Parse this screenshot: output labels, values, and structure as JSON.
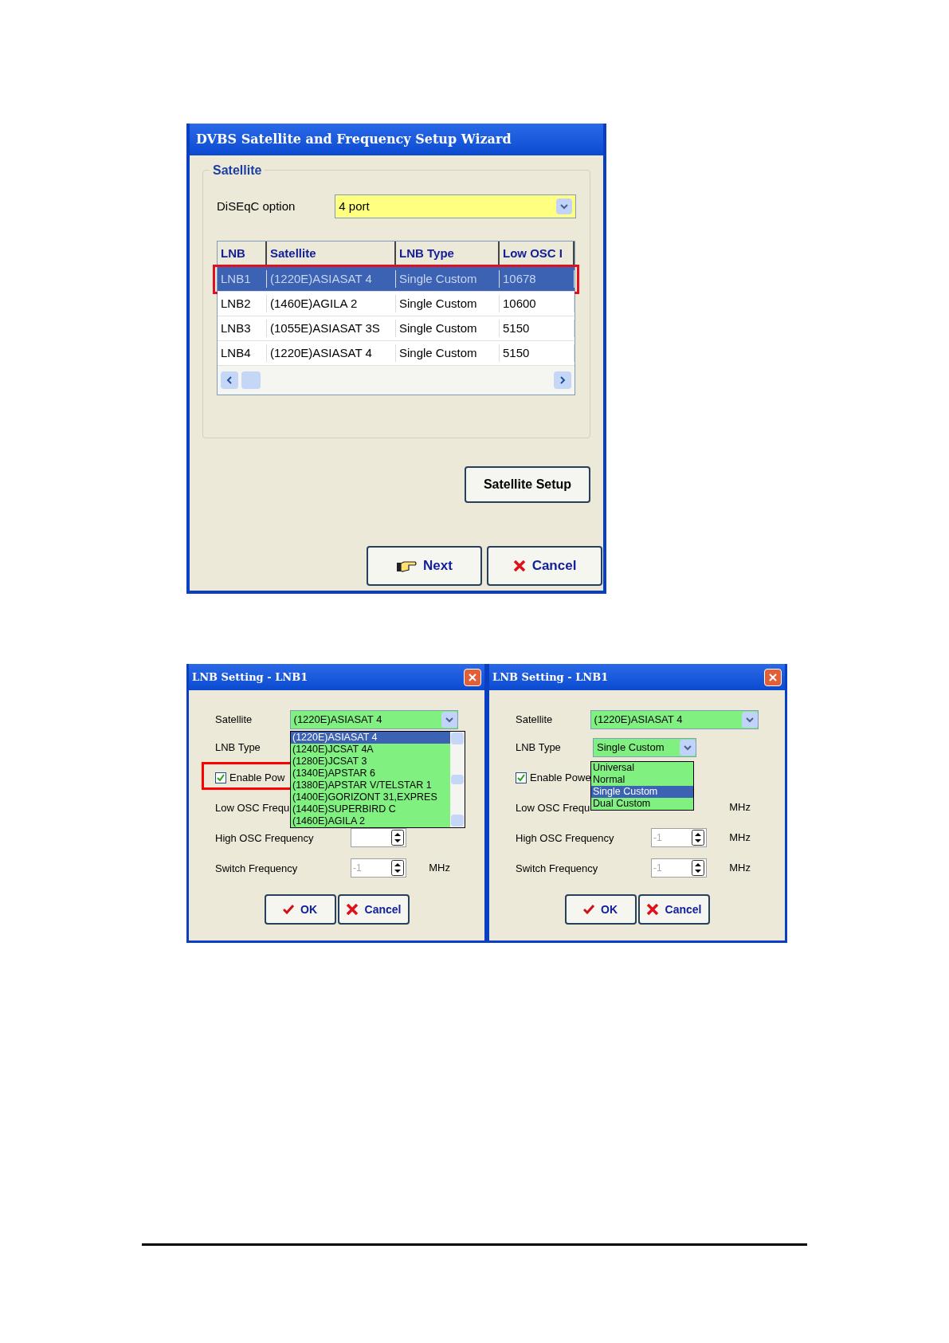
{
  "wizard": {
    "title": "DVBS Satellite and Frequency Setup Wizard",
    "group_title": "Satellite",
    "diseqc_label": "DiSEqC option",
    "diseqc_value": "4 port",
    "table": {
      "columns": [
        "LNB",
        "Satellite",
        "LNB Type",
        "Low OSC I"
      ],
      "rows": [
        {
          "cells": [
            "LNB1",
            "(1220E)ASIASAT 4",
            "Single Custom",
            "10678"
          ],
          "selected": true,
          "highlighted": true
        },
        {
          "cells": [
            "LNB2",
            "(1460E)AGILA 2",
            "Single Custom",
            "10600"
          ],
          "selected": false,
          "highlighted": false
        },
        {
          "cells": [
            "LNB3",
            "(1055E)ASIASAT 3S",
            "Single Custom",
            "5150"
          ],
          "selected": false,
          "highlighted": false
        },
        {
          "cells": [
            "LNB4",
            "(1220E)ASIASAT 4",
            "Single Custom",
            "5150"
          ],
          "selected": false,
          "highlighted": false
        }
      ]
    },
    "setup_button": "Satellite Setup",
    "next_button": "Next",
    "cancel_button": "Cancel"
  },
  "dialogs": [
    {
      "title": "LNB Setting - LNB1",
      "satellite_label": "Satellite",
      "satellite_value": "(1220E)ASIASAT 4",
      "lnb_type_label": "LNB Type",
      "enable_power": {
        "label": "Enable Pow",
        "checked": true,
        "highlighted": true
      },
      "rows": [
        {
          "label": "Low OSC Frequ"
        },
        {
          "label": "High OSC Frequency",
          "value": "",
          "unit": ""
        },
        {
          "label": "Switch Frequency",
          "value": "-1",
          "unit": "MHz"
        }
      ],
      "dropdown": {
        "kind": "satellite",
        "items": [
          {
            "label": "(1220E)ASIASAT 4",
            "selected": true
          },
          {
            "label": "(1240E)JCSAT 4A",
            "selected": false
          },
          {
            "label": "(1280E)JCSAT 3",
            "selected": false
          },
          {
            "label": "(1340E)APSTAR 6",
            "selected": false
          },
          {
            "label": "(1380E)APSTAR V/TELSTAR 1",
            "selected": false
          },
          {
            "label": "(1400E)GORIZONT 31,EXPRES",
            "selected": false
          },
          {
            "label": "(1440E)SUPERBIRD C",
            "selected": false
          },
          {
            "label": "(1460E)AGILA 2",
            "selected": false
          }
        ]
      },
      "ok_button": "OK",
      "cancel_button": "Cancel"
    },
    {
      "title": "LNB Setting - LNB1",
      "satellite_label": "Satellite",
      "satellite_value": "(1220E)ASIASAT 4",
      "lnb_type_label": "LNB Type",
      "lnb_type_value": "Single Custom",
      "enable_power": {
        "label": "Enable Powe",
        "checked": true,
        "highlighted": false
      },
      "rows": [
        {
          "label": "Low OSC Frequ",
          "unit": "MHz"
        },
        {
          "label": "High OSC Frequency",
          "value": "-1",
          "unit": "MHz"
        },
        {
          "label": "Switch Frequency",
          "value": "-1",
          "unit": "MHz"
        }
      ],
      "dropdown": {
        "kind": "lnb_type",
        "items": [
          {
            "label": "Universal",
            "selected": false
          },
          {
            "label": "Normal",
            "selected": false
          },
          {
            "label": "Single Custom",
            "selected": true
          },
          {
            "label": "Dual Custom",
            "selected": false
          }
        ]
      },
      "ok_button": "OK",
      "cancel_button": "Cancel"
    }
  ]
}
